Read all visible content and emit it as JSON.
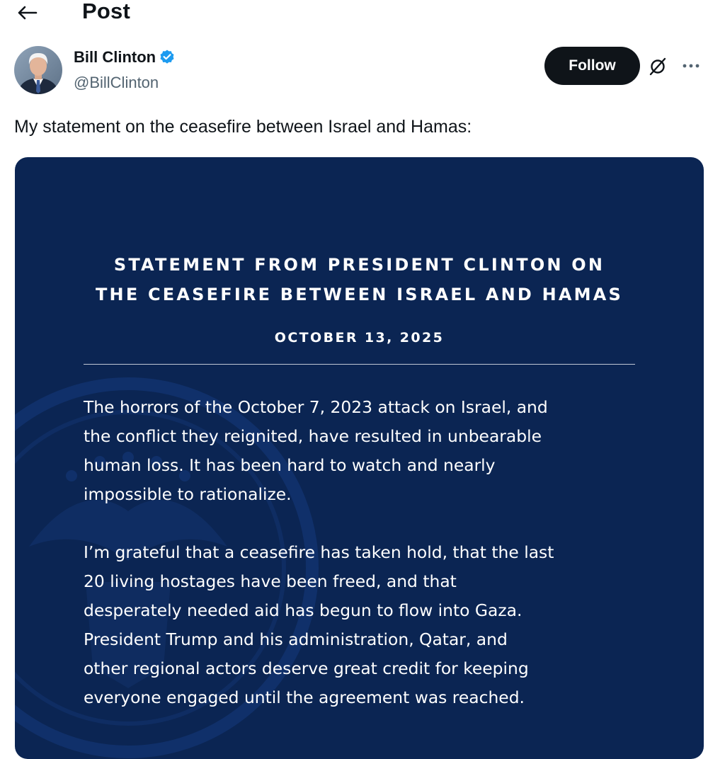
{
  "header": {
    "title": "Post",
    "back_icon": "arrow-left-icon"
  },
  "author": {
    "name": "Bill Clinton",
    "handle": "@BillClinton",
    "verified": true,
    "verified_color": "#1d9bf0",
    "avatar_icon": "avatar"
  },
  "actions": {
    "follow_label": "Follow",
    "follow_bg": "#0f1419",
    "grok_icon": "grok-icon",
    "more_icon": "more-icon"
  },
  "post": {
    "text": "My statement on the ceasefire between Israel and Hamas:"
  },
  "statement": {
    "background": "#0b2553",
    "title_lines": [
      "STATEMENT FROM PRESIDENT CLINTON ON",
      "THE CEASEFIRE BETWEEN ISRAEL AND HAMAS"
    ],
    "date": "OCTOBER 13, 2025",
    "paragraphs": [
      [
        "The horrors of the October 7, 2023 attack on Israel, and",
        "the conflict they reignited, have resulted in unbearable",
        "human loss. It has been hard to watch and nearly",
        "impossible to rationalize."
      ],
      [
        "I’m grateful that a ceasefire has taken hold, that the last",
        "20 living hostages have been freed, and that",
        "desperately needed aid has begun to flow into Gaza.",
        "President Trump and his administration, Qatar, and",
        "other regional actors deserve great credit for keeping",
        "everyone engaged until the agreement was reached."
      ]
    ]
  }
}
